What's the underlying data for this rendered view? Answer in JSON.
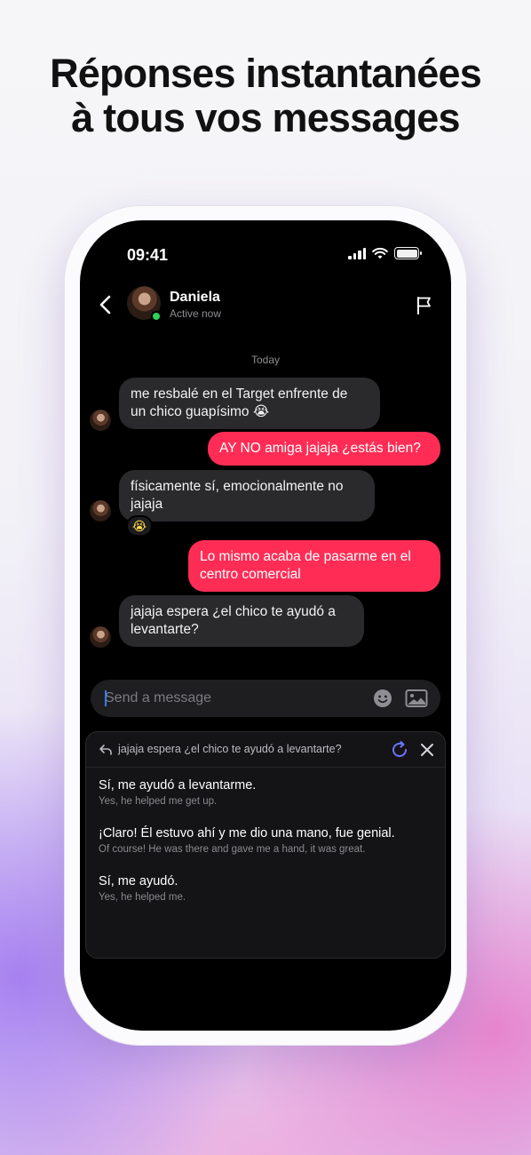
{
  "headline": {
    "line1": "Réponses instantanées",
    "line2": "à tous vos messages"
  },
  "status_bar": {
    "time": "09:41"
  },
  "chat_header": {
    "name": "Daniela",
    "status": "Active now"
  },
  "day_separator": "Today",
  "messages": [
    {
      "sender": "them",
      "line1": "me resbalé en el Target enfrente de",
      "line2": "un chico guapísimo 😭"
    },
    {
      "sender": "me",
      "line1": "AY NO amiga jajaja ¿estás bien?"
    },
    {
      "sender": "them",
      "line1": "físicamente sí, emocionalmente no",
      "line2": "jajaja",
      "reaction": "😭"
    },
    {
      "sender": "me",
      "line1": "Lo mismo acaba de pasarme en el",
      "line2": "centro comercial"
    },
    {
      "sender": "them",
      "line1": "jajaja espera ¿el chico te ayudó a",
      "line2": "levantarte?"
    }
  ],
  "composer": {
    "placeholder": "Send a message"
  },
  "reply_panel": {
    "quoted_message": "jajaja espera ¿el chico te ayudó a levantarte?",
    "suggestions": [
      {
        "text": "Sí, me ayudó a levantarme.",
        "translation": "Yes, he helped me get up."
      },
      {
        "text": "¡Claro! Él estuvo ahí y me dio una mano, fue genial.",
        "translation": "Of course! He was there and gave me a hand, it was great."
      },
      {
        "text": "Sí, me ayudó.",
        "translation": "Yes, he helped me."
      }
    ]
  },
  "colors": {
    "outgoing_bubble": "#ff2d55",
    "incoming_bubble": "#2a2a2d",
    "online": "#2fd157",
    "refresh_accent": "#6b73ff"
  },
  "icons": [
    "back-chevron-icon",
    "flag-icon",
    "emoji-icon",
    "image-icon",
    "reply-icon",
    "refresh-icon",
    "close-icon"
  ]
}
